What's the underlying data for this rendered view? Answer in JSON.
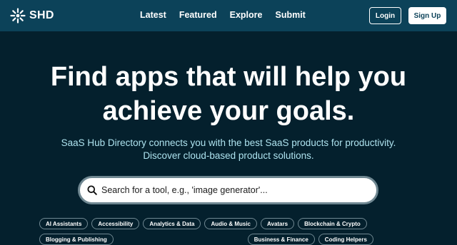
{
  "nav": {
    "logo_text": "SHD",
    "links": [
      "Latest",
      "Featured",
      "Explore",
      "Submit"
    ],
    "login_label": "Login",
    "signup_label": "Sign Up"
  },
  "hero": {
    "title_line1": "Find apps that will help you",
    "title_line2": "achieve your goals.",
    "subtitle_line1": "SaaS Hub Directory connects you with the best SaaS products for productivity.",
    "subtitle_line2": "Discover cloud-based product solutions."
  },
  "search": {
    "placeholder": "Search for a tool, e.g., 'image generator'...",
    "icon": "search-icon"
  },
  "categories": [
    "AI Assistants",
    "Accessibility",
    "Analytics & Data",
    "Audio & Music",
    "Avatars",
    "Blockchain & Crypto",
    "Blogging & Publishing",
    "Business & Finance",
    "Coding Helpers"
  ],
  "colors": {
    "nav_bg": "#0c4259",
    "page_bg": "#04202d",
    "subtitle": "#aee3ef",
    "chip_border": "#6f8791"
  }
}
